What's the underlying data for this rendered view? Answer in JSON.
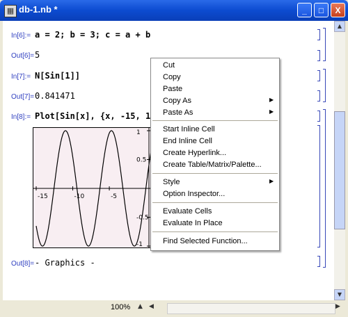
{
  "window": {
    "title": "db-1.nb *",
    "minimize": "_",
    "maximize": "□",
    "close": "X"
  },
  "cells": [
    {
      "in_label": "In[6]:=",
      "input": "a = 2; b = 3; c = a + b",
      "out_label": "Out[6]=",
      "output": "5"
    },
    {
      "in_label": "In[7]:=",
      "input": "N[Sin[1]]",
      "out_label": "Out[7]=",
      "output": "0.841471"
    },
    {
      "in_label": "In[8]:=",
      "input": "Plot[Sin[x], {x, -15, 15}]",
      "out_label": "Out[8]=",
      "output": "- Graphics -"
    }
  ],
  "plot": {
    "x_ticks": [
      "-15",
      "-10",
      "-5"
    ],
    "y_ticks": [
      "1",
      "0.5",
      "-0.5",
      "-1"
    ]
  },
  "chart_data": {
    "type": "line",
    "series": [
      {
        "function": "Sin[x]",
        "x_range": [
          -15,
          15
        ]
      }
    ],
    "x_ticks": [
      -15,
      -10,
      -5
    ],
    "y_ticks": [
      1,
      0.5,
      -0.5,
      -1
    ],
    "ylim": [
      -1,
      1
    ]
  },
  "context_menu": {
    "cut": "Cut",
    "copy": "Copy",
    "paste": "Paste",
    "copy_as": "Copy As",
    "paste_as": "Paste As",
    "start_inline": "Start Inline Cell",
    "end_inline": "End Inline Cell",
    "create_hyperlink": "Create Hyperlink...",
    "create_table": "Create Table/Matrix/Palette...",
    "style": "Style",
    "option_inspector": "Option Inspector...",
    "evaluate_cells": "Evaluate Cells",
    "evaluate_in_place": "Evaluate In Place",
    "find_selected": "Find Selected Function..."
  },
  "status": {
    "zoom": "100%"
  },
  "icons": {
    "submenu_arrow": "▶",
    "scroll_up": "▲",
    "scroll_down": "▼",
    "scroll_left": "◀",
    "scroll_right": "▶"
  }
}
